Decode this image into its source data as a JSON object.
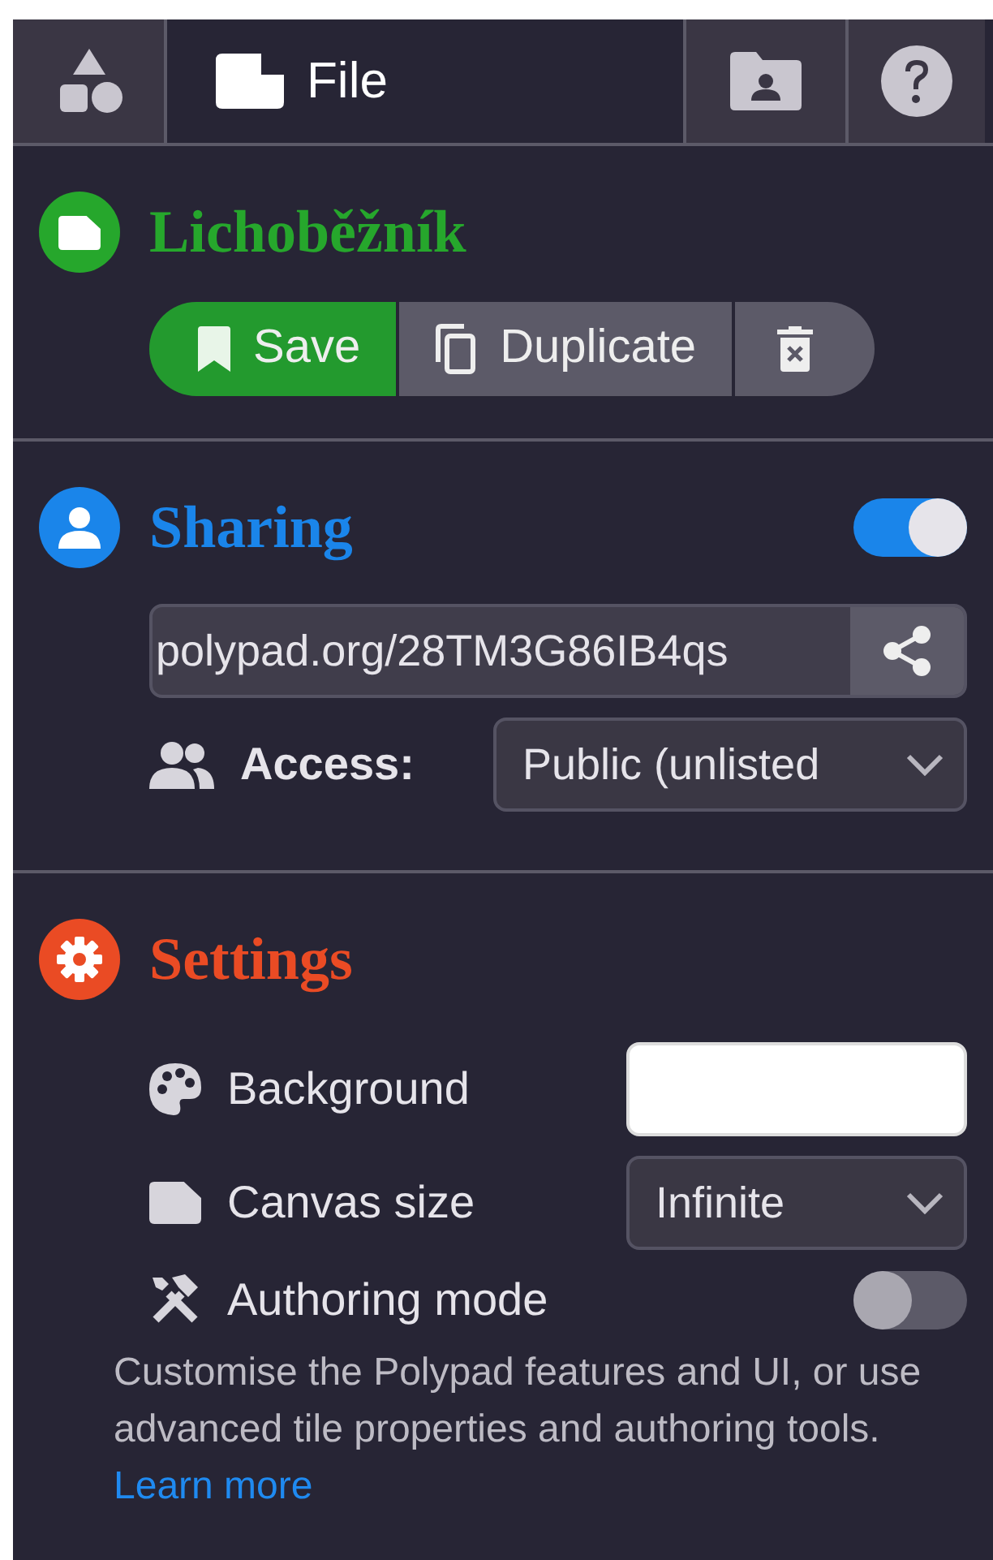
{
  "tabs": [
    {
      "kind": "shapes",
      "selected": false
    },
    {
      "kind": "file",
      "label": "File",
      "selected": true
    },
    {
      "kind": "folder",
      "selected": false
    },
    {
      "kind": "help",
      "selected": false
    }
  ],
  "file": {
    "title": "Lichoběžník",
    "buttons": [
      {
        "kind": "save",
        "label": "Save"
      },
      {
        "kind": "duplicate",
        "label": "Duplicate"
      },
      {
        "kind": "delete"
      }
    ]
  },
  "sharing": {
    "title": "Sharing",
    "on": true,
    "link": "polypad.org/28TM3G86IB4qs",
    "access_label": "Access:",
    "access_value": "Public (unlisted"
  },
  "settings": {
    "title": "Settings",
    "rows": [
      {
        "kind": "color",
        "label": "Background"
      },
      {
        "kind": "select",
        "label": "Canvas size",
        "value": "Infinite"
      },
      {
        "kind": "toggle",
        "label": "Authoring mode",
        "on": false
      }
    ],
    "description": "Customise the Polypad features and UI, or use advanced tile properties and authoring tools.",
    "link": "Learn more"
  }
}
